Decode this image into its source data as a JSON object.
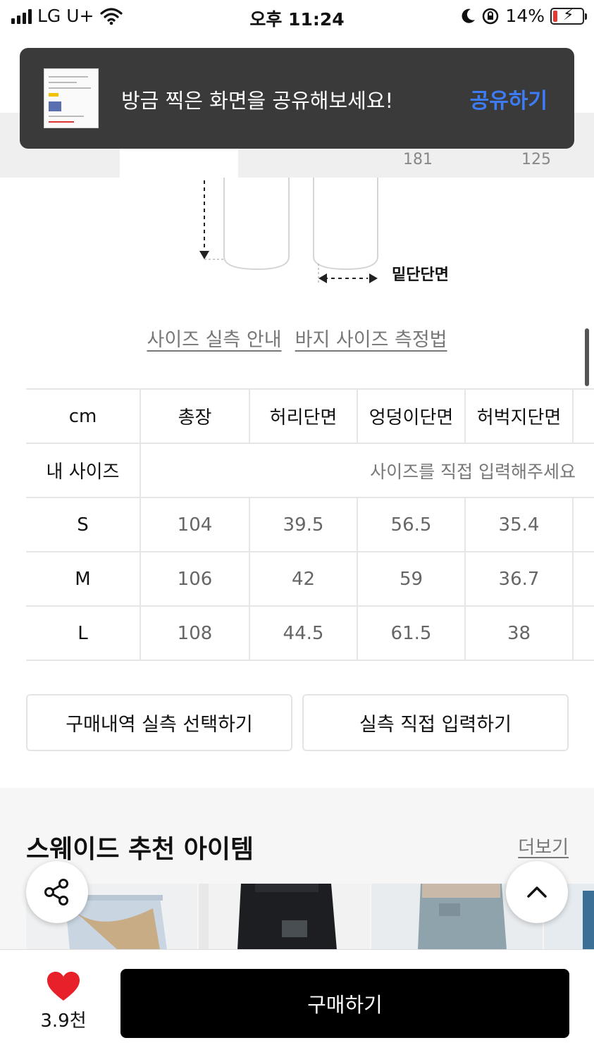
{
  "status_bar": {
    "carrier": "LG U+",
    "time": "오후 11:24",
    "battery_percent": "14%",
    "battery_level": 0.14,
    "battery_color": "#e53935"
  },
  "toast": {
    "message": "방금 찍은 화면을 공유해보세요!",
    "action": "공유하기",
    "action_color": "#3d7cf6"
  },
  "tab_stats": [
    "181",
    "125"
  ],
  "diagram": {
    "label": "밑단단면"
  },
  "links": {
    "size_guide": "사이즈 실측 안내",
    "measure_guide": "바지 사이즈 측정법"
  },
  "size_table": {
    "headers": [
      "cm",
      "총장",
      "허리단면",
      "엉덩이단면",
      "허벅지단면"
    ],
    "my_size": {
      "label": "내 사이즈",
      "placeholder": "사이즈를 직접 입력해주세요"
    },
    "rows": [
      {
        "size": "S",
        "values": [
          "104",
          "39.5",
          "56.5",
          "35.4"
        ]
      },
      {
        "size": "M",
        "values": [
          "106",
          "42",
          "59",
          "36.7"
        ]
      },
      {
        "size": "L",
        "values": [
          "108",
          "44.5",
          "61.5",
          "38"
        ]
      }
    ]
  },
  "buttons": {
    "select_from_history": "구매내역 실측 선택하기",
    "enter_directly": "실측 직접 입력하기"
  },
  "recommendations": {
    "title": "스웨이드 추천 아이템",
    "more": "더보기"
  },
  "bottom_bar": {
    "like_count": "3.9천",
    "buy": "구매하기",
    "heart_color": "#e8202a"
  },
  "icons": [
    "share-icon",
    "chevron-up-icon",
    "heart-icon",
    "wifi-icon",
    "moon-icon",
    "rotation-lock-icon",
    "battery-icon"
  ]
}
